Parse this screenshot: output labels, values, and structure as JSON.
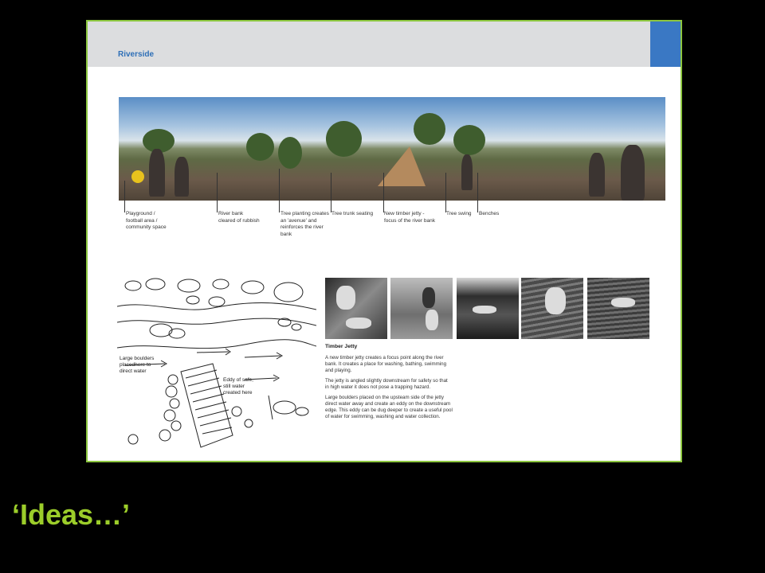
{
  "panel": {
    "title": "Riverside",
    "callouts": [
      {
        "text": "Playground /\nfootball area /\ncommunity space"
      },
      {
        "text": "River bank\ncleared of rubbish"
      },
      {
        "text": "Tree planting creates\nan 'avenue' and\nreinforces the river\nbank"
      },
      {
        "text": "Tree trunk seating"
      },
      {
        "text": "New timber jetty -\nfocus of the river bank"
      },
      {
        "text": "Tree swing"
      },
      {
        "text": "Benches"
      }
    ],
    "sketch_labels": [
      {
        "text": "Large boulders\nplacedhere to\ndirect water"
      },
      {
        "text": "Eddy of safe,\nstill water\ncreated here"
      }
    ],
    "jetty": {
      "title": "Timber Jetty",
      "paragraphs": [
        "A new timber jetty creates a focus point along the river bank. It creates a place for washing, bathing, swimming and playing.",
        "The jetty is angled slightly downstream for safety so that in high water it does not pose a trapping hazard.",
        "Large boulders placed on the upsteam side of the jetty direct water away and create an eddy on the downstream edge. This eddy can be dug deeper to create a useful pool of water for swimming, washing and water collection."
      ]
    }
  },
  "slide_caption": "‘Ideas…’",
  "colors": {
    "frame": "#8cc63f",
    "title": "#2e6fb7",
    "caption": "#9ccd2a",
    "accent": "#3a78c4"
  }
}
